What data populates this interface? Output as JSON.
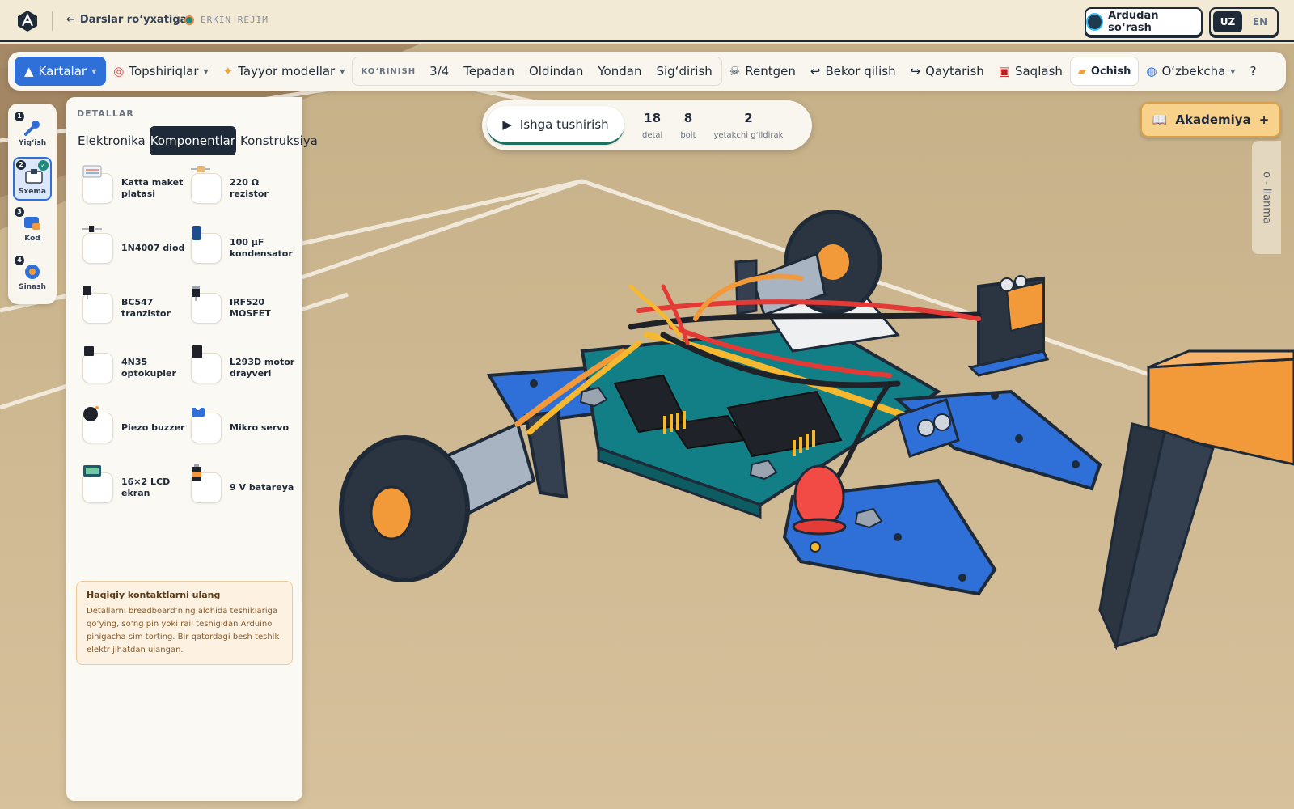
{
  "topbar": {
    "back_label": "Darslar ro‘yxatiga",
    "mode_label": "ERKIN REJIM",
    "ask_label": "Ardudan so‘rash",
    "lang_uz": "UZ",
    "lang_en": "EN"
  },
  "toolbar": {
    "cards": "Kartalar",
    "tasks": "Topshiriqlar",
    "models": "Tayyor modellar",
    "view_label": "KO‘RINISH",
    "view_34": "3/4",
    "view_top": "Tepadan",
    "view_front": "Oldindan",
    "view_side": "Yondan",
    "view_fit": "Sig‘dirish",
    "xray": "Rentgen",
    "undo": "Bekor qilish",
    "redo": "Qaytarish",
    "save": "Saqlash",
    "open": "Ochish",
    "language": "O‘zbekcha",
    "help": "?"
  },
  "steps": [
    {
      "num": "1",
      "label": "Yig‘ish",
      "icon": "wrench-icon"
    },
    {
      "num": "2",
      "label": "Sxema",
      "icon": "breadboard-icon",
      "done": true
    },
    {
      "num": "3",
      "label": "Kod",
      "icon": "code-icon"
    },
    {
      "num": "4",
      "label": "Sinash",
      "icon": "gear-icon"
    }
  ],
  "panel": {
    "title": "DETALLAR",
    "tabs": [
      "Elektronika",
      "Komponentlar",
      "Konstruksiya"
    ],
    "active_tab": "Komponentlar",
    "components": [
      {
        "name": "Katta maket platasi",
        "icon": "breadboard-icon"
      },
      {
        "name": "220 Ω rezistor",
        "icon": "resistor-icon"
      },
      {
        "name": "1N4007 diod",
        "icon": "diode-icon"
      },
      {
        "name": "100 µF kondensator",
        "icon": "capacitor-icon"
      },
      {
        "name": "BC547 tranzistor",
        "icon": "transistor-icon"
      },
      {
        "name": "IRF520 MOSFET",
        "icon": "mosfet-icon"
      },
      {
        "name": "4N35 optokupler",
        "icon": "chip-icon"
      },
      {
        "name": "L293D motor drayveri",
        "icon": "chip-icon"
      },
      {
        "name": "Piezo buzzer",
        "icon": "buzzer-icon"
      },
      {
        "name": "Mikro servo",
        "icon": "servo-icon"
      },
      {
        "name": "16×2 LCD ekran",
        "icon": "lcd-icon"
      },
      {
        "name": "9 V batareya",
        "icon": "battery-icon"
      }
    ],
    "tip_title": "Haqiqiy kontaktlarni ulang",
    "tip_text": "Detallarni breadboard’ning alohida teshiklariga qo‘ying, so‘ng pin yoki rail teshigidan Arduino pinigacha sim torting. Bir qatordagi besh teshik elektr jihatdan ulangan."
  },
  "run": {
    "label": "Ishga tushirish",
    "stats": [
      {
        "value": "18",
        "label": "detal"
      },
      {
        "value": "8",
        "label": "bolt"
      },
      {
        "value": "2",
        "label": "yetakchi g‘ildirak"
      }
    ]
  },
  "academy": {
    "label": "Akademiya",
    "plus": "+"
  },
  "side_tab": "o - llanma"
}
